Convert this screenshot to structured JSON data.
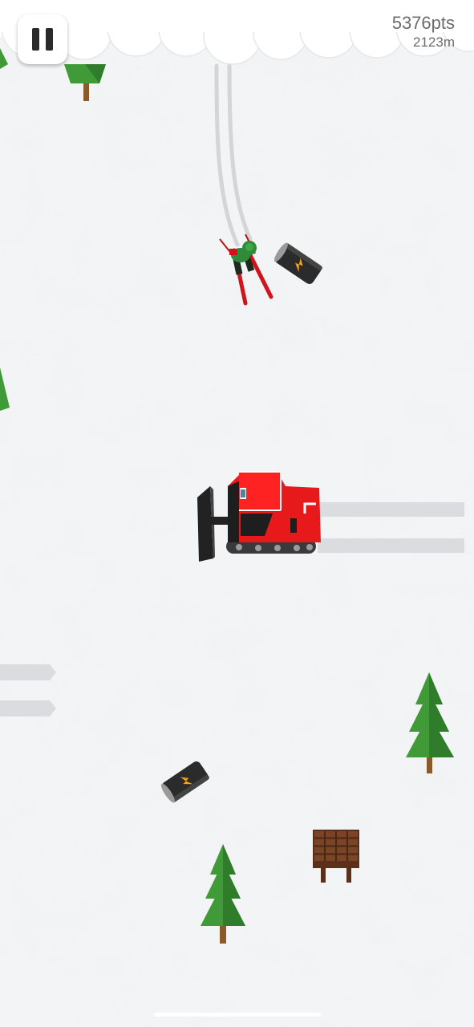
{
  "hud": {
    "points": "5376pts",
    "distance": "2123m",
    "pause_icon": "pause-icon"
  },
  "scene": {
    "background": "snow-slope",
    "objects": [
      "skier",
      "snow-groomer",
      "energy-drink-can",
      "energy-drink-can",
      "pine-tree",
      "pine-tree",
      "pine-tree",
      "pine-tree",
      "wooden-bench"
    ]
  },
  "colors": {
    "snow": "#f4f5f6",
    "groomer_body": "#e8191b",
    "tree_green": "#3f9a37",
    "trunk": "#8a5a2b",
    "skier_suit": "#2e8b3a",
    "ski": "#d0141b",
    "can": "#2b2b2b",
    "bolt": "#f2a31b",
    "bench": "#6b3b1f",
    "hud_text": "#6c6c6c"
  }
}
